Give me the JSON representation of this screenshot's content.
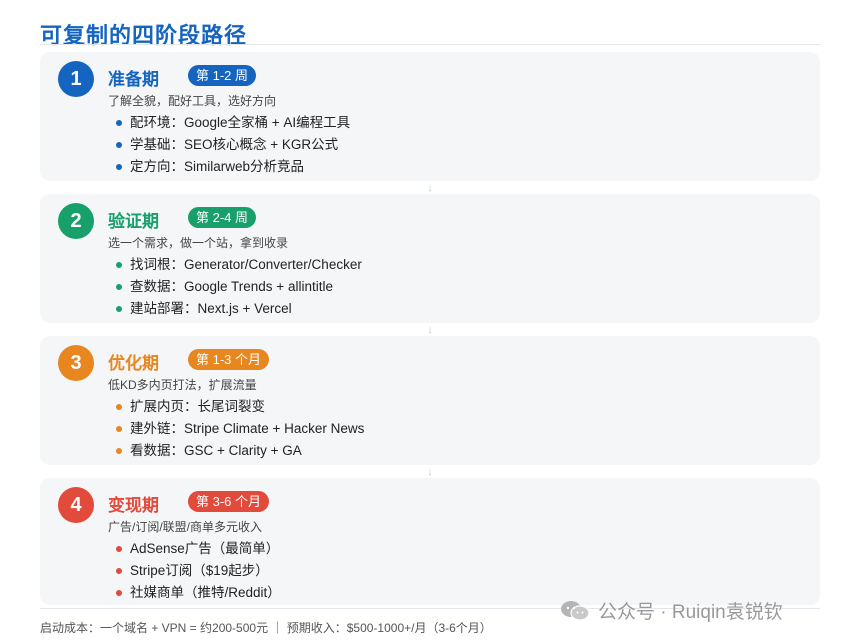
{
  "title": "可复制的四阶段路径",
  "stages": [
    {
      "number": "1",
      "name": "准备期",
      "period": "第 1-2 周",
      "color": "#1565c0",
      "description": "了解全貌，配好工具，选好方向",
      "items": [
        "配环境：Google全家桶 + AI编程工具",
        "学基础：SEO核心概念 + KGR公式",
        "定方向：Similarweb分析竞品"
      ]
    },
    {
      "number": "2",
      "name": "验证期",
      "period": "第 2-4 周",
      "color": "#17a06a",
      "description": "选一个需求，做一个站，拿到收录",
      "items": [
        "找词根：Generator/Converter/Checker",
        "查数据：Google Trends + allintitle",
        "建站部署：Next.js + Vercel"
      ]
    },
    {
      "number": "3",
      "name": "优化期",
      "period": "第 1-3 个月",
      "color": "#e8861f",
      "description": "低KD多内页打法，扩展流量",
      "items": [
        "扩展内页：长尾词裂变",
        "建外链：Stripe Climate + Hacker News",
        "看数据：GSC + Clarity + GA"
      ]
    },
    {
      "number": "4",
      "name": "变现期",
      "period": "第 3-6 个月",
      "color": "#e24a3b",
      "description": "广告/订阅/联盟/商单多元收入",
      "items": [
        "AdSense广告（最简单）",
        "Stripe订阅（$19起步）",
        "社媒商单（推特/Reddit）"
      ]
    }
  ],
  "footer": "启动成本：一个域名 + VPN = 约200-500元 ｜ 预期收入：$500-1000+/月（3-6个月）",
  "watermark": {
    "icon": "wechat-icon",
    "text": "公众号 · Ruiqin袁锐钦"
  }
}
